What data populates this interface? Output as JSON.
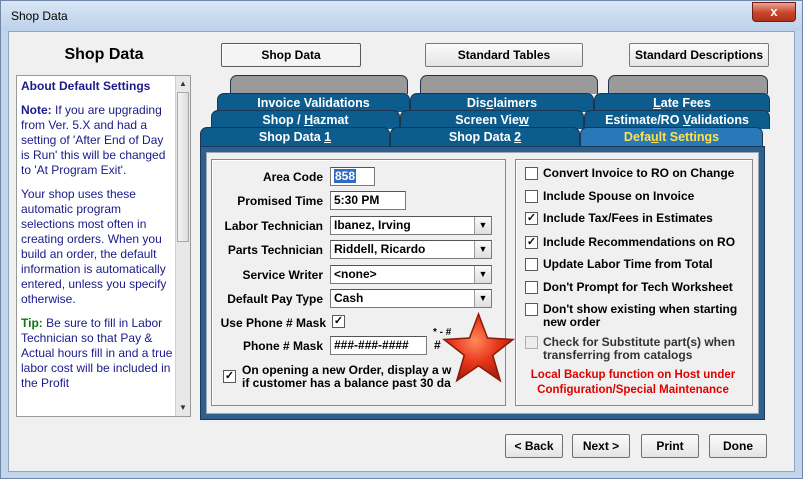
{
  "window": {
    "title": "Shop Data",
    "close_glyph": "x"
  },
  "heading": "Shop Data",
  "top_buttons": {
    "shop_data": "Shop Data",
    "standard_tables": "Standard Tables",
    "standard_descriptions": "Standard Descriptions"
  },
  "help": {
    "title": "About Default Settings",
    "note_label": "Note:",
    "note_text": " If you are upgrading from Ver. 5.X and had a setting of 'After End of Day is Run' this will be changed to 'At Program Exit'.",
    "para2": "Your shop uses these automatic program selections most often in creating orders. When you build an order, the default information is automatically entered, unless you specify otherwise.",
    "tip_label": "Tip:",
    "tip_text": " Be sure to fill in Labor Technician so that Pay & Actual hours fill in and a true labor cost will be included in the Profit"
  },
  "tabs": {
    "invoice_validations": "Invoice Validations",
    "disclaimers_a": "Dis",
    "disclaimers_b": "c",
    "disclaimers_c": "laimers",
    "late_fees_a": "L",
    "late_fees_b": "ate Fees",
    "shop_hazmat_a": "Shop / ",
    "shop_hazmat_b": "H",
    "shop_hazmat_c": "azmat",
    "screen_view_a": "Screen Vie",
    "screen_view_b": "w",
    "estimate_ro_a": "Estimate/RO ",
    "estimate_ro_b": "V",
    "estimate_ro_c": "alidations",
    "shop_data1_a": "Shop Data ",
    "shop_data1_b": "1",
    "shop_data2_a": "Shop Data ",
    "shop_data2_b": "2",
    "default_settings_a": "Defa",
    "default_settings_b": "u",
    "default_settings_c": "lt Settings"
  },
  "form": {
    "area_code_label": "Area Code",
    "area_code_value": "858",
    "promised_time_label": "Promised Time",
    "promised_time_value": "5:30 PM",
    "labor_tech_label": "Labor Technician",
    "labor_tech_value": "Ibanez, Irving",
    "parts_tech_label": "Parts Technician",
    "parts_tech_value": "Riddell, Ricardo",
    "service_writer_label": "Service Writer",
    "service_writer_value": "<none>",
    "pay_type_label": "Default Pay Type",
    "pay_type_value": "Cash",
    "phone_mask_use_label": "Use Phone # Mask",
    "phone_mask_label": "Phone # Mask",
    "phone_mask_value": "###-###-####",
    "phone_mask_extra": "#",
    "phone_mask_note": "* - #",
    "balance_line1": "On opening a new Order, display a w",
    "balance_line2": "if customer has a balance past 30 da"
  },
  "options": {
    "convert_invoice": "Convert Invoice to RO on Change",
    "include_spouse": "Include Spouse on Invoice",
    "include_tax": "Include Tax/Fees in Estimates",
    "include_recs": "Include Recommendations on RO",
    "update_labor": "Update Labor Time from Total",
    "dont_prompt": "Don't Prompt for Tech Worksheet",
    "dont_show_1": "Don't show existing when starting",
    "dont_show_2": "new order",
    "check_sub_1": "Check for Substitute part(s) when",
    "check_sub_2": "transferring from catalogs",
    "check_mark": "✓"
  },
  "warning": {
    "line1": "Local Backup function on Host under",
    "line2": "Configuration/Special Maintenance"
  },
  "bottom_buttons": {
    "back": "< Back",
    "next": "Next >",
    "print": "Print",
    "done": "Done"
  },
  "colors": {
    "tab_blue": "#0d5c8e",
    "active_tab_text": "#ffe14b",
    "warning_red": "#e10000",
    "help_text": "#1a1a8c"
  }
}
